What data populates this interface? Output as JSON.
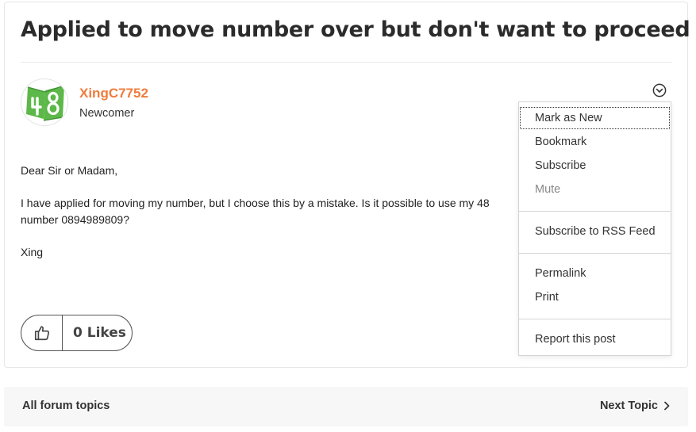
{
  "post": {
    "title": "Applied to move number over but don't want to proceed",
    "author": {
      "name": "XingC7752",
      "rank": "Newcomer"
    },
    "body": {
      "greeting": "Dear Sir or Madam,",
      "line1": "I have applied for moving my number, but I choose this by a mistake. Is it possible to use my 48",
      "line2": "number 0894989809?",
      "signoff": "Xing"
    },
    "likes_count_label": "0 Likes"
  },
  "options_menu": {
    "items": [
      {
        "label": "Mark as New",
        "state": "focused"
      },
      {
        "label": "Bookmark"
      },
      {
        "label": "Subscribe"
      },
      {
        "label": "Mute",
        "state": "disabled"
      },
      {
        "label": "Subscribe to RSS Feed"
      },
      {
        "label": "Permalink"
      },
      {
        "label": "Print"
      },
      {
        "label": "Report this post"
      }
    ]
  },
  "footer": {
    "all_topics_label": "All forum topics",
    "next_topic_label": "Next Topic"
  },
  "colors": {
    "author_name": "#f07c3c",
    "avatar_green": "#5cb848"
  },
  "icons": {
    "avatar": "48-logo",
    "options": "chevron-circle-down-icon",
    "like": "thumbs-up-icon",
    "next": "chevron-right-icon"
  }
}
